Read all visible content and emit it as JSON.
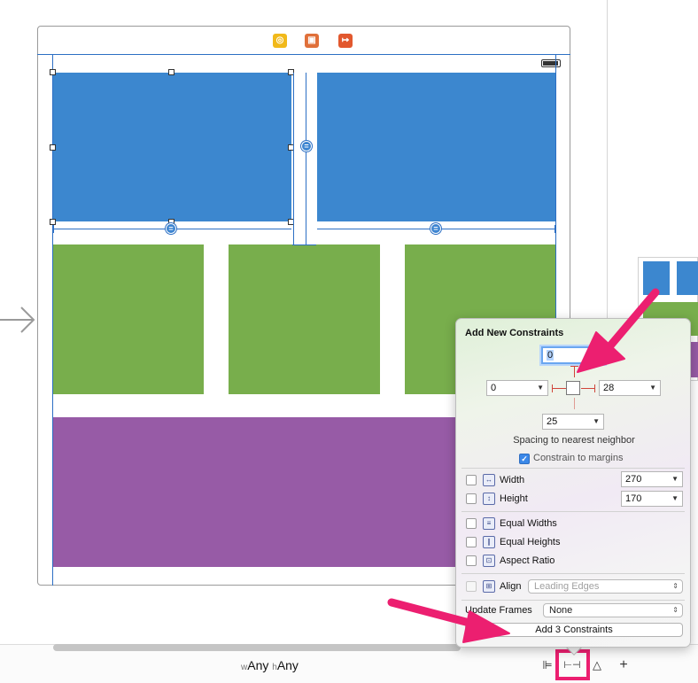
{
  "popover": {
    "title": "Add New Constraints",
    "top_value": "0",
    "left_value": "0",
    "right_value": "28",
    "bottom_value": "25",
    "spacing_label": "Spacing to nearest neighbor",
    "constrain_margins_label": "Constrain to margins",
    "constrain_margins_checked": true,
    "width": {
      "label": "Width",
      "value": "270",
      "checked": false,
      "icon": "width-icon"
    },
    "height": {
      "label": "Height",
      "value": "170",
      "checked": false,
      "icon": "height-icon"
    },
    "equal_widths": {
      "label": "Equal Widths",
      "checked": false,
      "icon": "equal-widths-icon"
    },
    "equal_heights": {
      "label": "Equal Heights",
      "checked": false,
      "icon": "equal-heights-icon"
    },
    "aspect_ratio": {
      "label": "Aspect Ratio",
      "checked": false,
      "icon": "aspect-ratio-icon"
    },
    "align": {
      "label": "Align",
      "value": "Leading Edges",
      "checked": false,
      "icon": "align-icon"
    },
    "update_frames_label": "Update Frames",
    "update_frames_value": "None",
    "add_button_label": "Add 3 Constraints"
  },
  "bottom_bar": {
    "size_class_w_prefix": "w",
    "size_class_w": "Any",
    "size_class_h_prefix": "h",
    "size_class_h": "Any",
    "align_btn": "⊫",
    "pin_btn": "⊢⊣",
    "resolve_btn": "△",
    "add_btn": "+"
  },
  "colors": {
    "blue_view": "#3c87cf",
    "green_view": "#78ae4c",
    "purple_view": "#975ba6",
    "annotation_pink": "#ec1f70",
    "constraint_line": "#2c6fc4"
  }
}
